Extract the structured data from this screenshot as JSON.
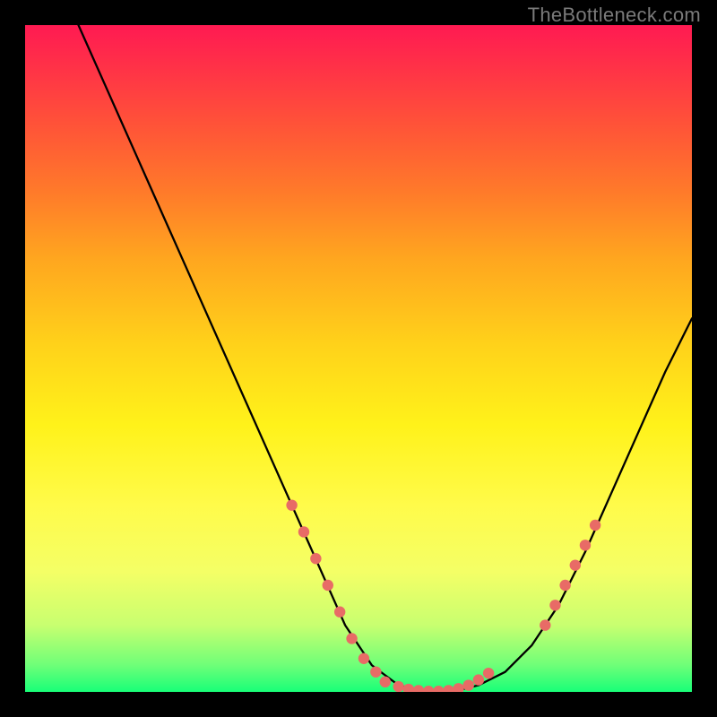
{
  "watermark": "TheBottleneck.com",
  "chart_data": {
    "type": "line",
    "title": "",
    "xlabel": "",
    "ylabel": "",
    "xlim": [
      0,
      100
    ],
    "ylim": [
      0,
      100
    ],
    "series": [
      {
        "name": "curve",
        "color": "#000000",
        "x": [
          8,
          12,
          16,
          20,
          24,
          28,
          32,
          36,
          40,
          44,
          48,
          52,
          56,
          60,
          64,
          68,
          72,
          76,
          80,
          84,
          88,
          92,
          96,
          100
        ],
        "y": [
          100,
          91,
          82,
          73,
          64,
          55,
          46,
          37,
          28,
          19,
          10,
          4,
          1,
          0,
          0,
          1,
          3,
          7,
          13,
          21,
          30,
          39,
          48,
          56
        ]
      },
      {
        "name": "fit-markers-left",
        "color": "#e86b66",
        "type": "scatter",
        "x": [
          40,
          41.8,
          43.6,
          45.4,
          47.2,
          49,
          50.8,
          52.6
        ],
        "y": [
          28,
          24,
          20,
          16,
          12,
          8,
          5,
          3
        ]
      },
      {
        "name": "fit-markers-bottom",
        "color": "#e86b66",
        "type": "scatter",
        "x": [
          54,
          56,
          57.5,
          59,
          60.5,
          62,
          63.5,
          65,
          66.5,
          68,
          69.5
        ],
        "y": [
          1.5,
          0.8,
          0.4,
          0.2,
          0.1,
          0.1,
          0.2,
          0.5,
          1.0,
          1.8,
          2.8
        ]
      },
      {
        "name": "fit-markers-right",
        "color": "#e86b66",
        "type": "scatter",
        "x": [
          78,
          79.5,
          81,
          82.5,
          84,
          85.5
        ],
        "y": [
          10,
          13,
          16,
          19,
          22,
          25
        ]
      }
    ],
    "gradient_stops": [
      {
        "pos": 0,
        "color": "#ff1a52"
      },
      {
        "pos": 7,
        "color": "#ff3446"
      },
      {
        "pos": 15,
        "color": "#ff5338"
      },
      {
        "pos": 25,
        "color": "#ff7a2a"
      },
      {
        "pos": 35,
        "color": "#ffa61f"
      },
      {
        "pos": 48,
        "color": "#ffd21a"
      },
      {
        "pos": 60,
        "color": "#fff21a"
      },
      {
        "pos": 72,
        "color": "#fffb4a"
      },
      {
        "pos": 82,
        "color": "#f4ff66"
      },
      {
        "pos": 90,
        "color": "#c8ff70"
      },
      {
        "pos": 96,
        "color": "#6eff78"
      },
      {
        "pos": 100,
        "color": "#18ff78"
      }
    ]
  }
}
